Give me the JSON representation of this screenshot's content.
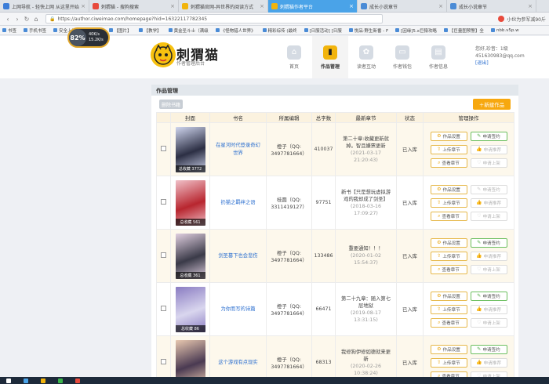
{
  "browser": {
    "tabs": [
      {
        "label": "上网导航 - 轻快上网 从这里开始",
        "color": "#3b7dd8"
      },
      {
        "label": "刺猬猫 - 搜狗搜索",
        "color": "#e84a3c"
      },
      {
        "label": "刺猬猫官网-异世界的阅读方式",
        "color": "#f2b40c"
      },
      {
        "label": "刺猬猫作者平台",
        "color": "#f2b40c"
      },
      {
        "label": "成长小说章节",
        "color": "#4a8bd6"
      },
      {
        "label": "成长小说章节",
        "color": "#4a8bd6"
      }
    ],
    "active_tab": 3,
    "url": "https://author.ciweimao.com/homepage?hid=16322117782345",
    "addr_right_text": "小伙为参军减90斤",
    "bookmarks": [
      "书签",
      "手机书签",
      "安全上网",
      "优惠券",
      "【图片】",
      "【教学】",
      "黄金圣斗士（满级",
      "《怪物猎人世界》",
      "精彩综传 (最终",
      "[日服活动] [日服",
      "悦品·野生新番 - F",
      "[因缘]5.x巨猿攻略",
      "【巨量图预警】全",
      "nbb.v5p.w"
    ],
    "widget": {
      "percent": "82%",
      "up": "40K/s",
      "down": "15.2K/s"
    }
  },
  "header": {
    "brand": "刺猬猫",
    "subtitle": "作者管理后台",
    "nav": [
      {
        "label": "首页",
        "icon": "home-icon",
        "glyph": "⌂"
      },
      {
        "label": "作品管理",
        "icon": "book-icon",
        "glyph": "▮"
      },
      {
        "label": "读者互动",
        "icon": "paw-icon",
        "glyph": "✿"
      },
      {
        "label": "作者钱包",
        "icon": "wallet-icon",
        "glyph": "▭"
      },
      {
        "label": "作者信息",
        "icon": "info-icon",
        "glyph": "▤"
      }
    ],
    "active_nav": 1,
    "user": {
      "greeting": "您好,珍音：1级",
      "email": "451630983@qq.com",
      "logout": "[退出]"
    }
  },
  "panel": {
    "title": "作品管理",
    "delete_btn": "删除书籍",
    "new_btn": "＋新建作品",
    "columns": [
      "",
      "封面",
      "书名",
      "所属编辑",
      "总字数",
      "最新章节",
      "状态",
      "管理操作"
    ],
    "op_labels": {
      "settings": "作品设置",
      "sign": "申请签约",
      "upload": "上传章节",
      "recommend": "申请推荐",
      "view": "查看章节",
      "shelve": "申请上架"
    },
    "rows": [
      {
        "cover_caption": "总收藏 3772",
        "cover_colors": [
          "#2c2f44",
          "#cfd5ee"
        ],
        "title": "在星河时代登录奇幻世界",
        "editor": "橙子（QQ: 3497781664）",
        "words": "410037",
        "chapter": "第二十章:收藏更新就掉。智且嫌票更新",
        "date": "(2021-03-17 21:20:43)",
        "status": "已入库",
        "sign_disabled": false
      },
      {
        "cover_caption": "总收藏 561",
        "cover_colors": [
          "#b8262f",
          "#f0c0c8"
        ],
        "title": "扔猫之羁绊之语",
        "editor": "桂圆（QQ: 3311419127）",
        "words": "97751",
        "chapter": "新书【只是想玩虚拟游戏的我却成了剑圣】",
        "date": "(2018-03-16 17:09:27)",
        "status": "已入库",
        "sign_disabled": true
      },
      {
        "cover_caption": "总收藏 361",
        "cover_colors": [
          "#3a3a48",
          "#e0cfe0"
        ],
        "title": "剑圣篡下也会悲伤",
        "editor": "橙子（QQ: 3497781664）",
        "words": "133486",
        "chapter": "重要通知！！！",
        "date": "(2020-01-02 15:54:37)",
        "status": "已入库",
        "sign_disabled": false
      },
      {
        "cover_caption": "总收藏 86",
        "cover_colors": [
          "#d9d6ee",
          "#8a7cc2"
        ],
        "title": "为你而写的诗篇",
        "editor": "橙子（QQ: 3497781664）",
        "words": "66471",
        "chapter": "第二十九章：随入第七层地狱",
        "date": "(2019-08-17 13:31:15)",
        "status": "已入库",
        "sign_disabled": false
      },
      {
        "cover_caption": "总收藏 102",
        "cover_colors": [
          "#4a3a52",
          "#e8c8b0"
        ],
        "title": "这个游戏有点现实",
        "editor": "橙子（QQ: 3497781664）",
        "words": "68313",
        "chapter": "我修狗伊修如德就来更新",
        "date": "(2020-02-26 10:38:24)",
        "status": "已入库",
        "sign_disabled": false
      }
    ]
  },
  "colors": {
    "accent": "#f7a80f",
    "link": "#2a6ecf",
    "active_tab": "#4aa3e8",
    "green": "#4aa63c"
  }
}
